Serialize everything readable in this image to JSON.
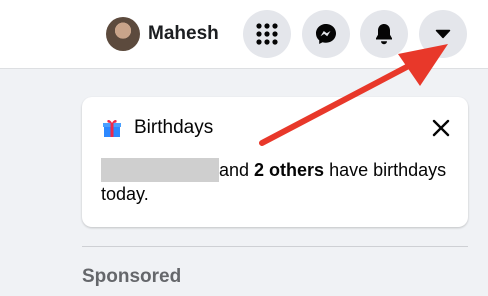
{
  "header": {
    "profile_name": "Mahesh",
    "buttons": [
      {
        "icon": "menu-grid-icon"
      },
      {
        "icon": "messenger-icon"
      },
      {
        "icon": "bell-icon"
      },
      {
        "icon": "caret-down-icon"
      }
    ]
  },
  "birthday_card": {
    "icon": "gift-icon",
    "title": "Birthdays",
    "text_part1": "and ",
    "text_bold": "2 others",
    "text_part2": " have birthdays today."
  },
  "sponsored": {
    "label": "Sponsored"
  },
  "colors": {
    "annotation_arrow": "#e8382a",
    "button_bg": "#e4e6eb",
    "page_bg": "#f0f2f5"
  }
}
